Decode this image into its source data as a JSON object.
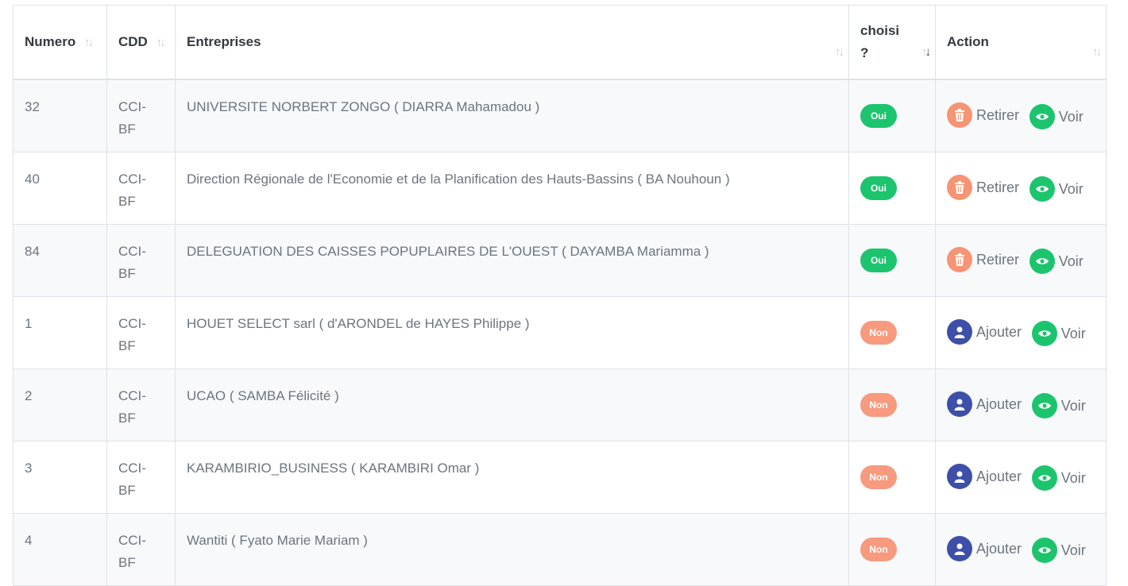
{
  "headers": {
    "numero": "Numero",
    "cdd": "CDD",
    "entreprises": "Entreprises",
    "choisi_line1": "choisi",
    "choisi_line2": "?",
    "action": "Action"
  },
  "sort_icon": {
    "up": "↑",
    "down": "↓"
  },
  "rows": [
    {
      "numero": "32",
      "cdd_1": "CCI-",
      "cdd_2": "BF",
      "entreprise": "UNIVERSITE NORBERT ZONGO ( DIARRA Mahamadou )",
      "choisi": "Oui",
      "action1": "Retirer",
      "action2": "Voir"
    },
    {
      "numero": "40",
      "cdd_1": "CCI-",
      "cdd_2": "BF",
      "entreprise": "Direction Régionale de l'Economie et de la Planification des Hauts-Bassins ( BA Nouhoun )",
      "choisi": "Oui",
      "action1": "Retirer",
      "action2": "Voir"
    },
    {
      "numero": "84",
      "cdd_1": "CCI-",
      "cdd_2": "BF",
      "entreprise": "DELEGUATION DES CAISSES POPUPLAIRES DE L'OUEST ( DAYAMBA Mariamma )",
      "choisi": "Oui",
      "action1": "Retirer",
      "action2": "Voir"
    },
    {
      "numero": "1",
      "cdd_1": "CCI-",
      "cdd_2": "BF",
      "entreprise": "HOUET SELECT sarl ( d'ARONDEL de HAYES Philippe )",
      "choisi": "Non",
      "action1": "Ajouter",
      "action2": "Voir"
    },
    {
      "numero": "2",
      "cdd_1": "CCI-",
      "cdd_2": "BF",
      "entreprise": "UCAO ( SAMBA Félicité )",
      "choisi": "Non",
      "action1": "Ajouter",
      "action2": "Voir"
    },
    {
      "numero": "3",
      "cdd_1": "CCI-",
      "cdd_2": "BF",
      "entreprise": "KARAMBIRIO_BUSINESS ( KARAMBIRI Omar )",
      "choisi": "Non",
      "action1": "Ajouter",
      "action2": "Voir"
    },
    {
      "numero": "4",
      "cdd_1": "CCI-",
      "cdd_2": "BF",
      "entreprise": "Wantiti ( Fyato Marie Mariam )",
      "choisi": "Non",
      "action1": "Ajouter",
      "action2": "Voir"
    }
  ],
  "colors": {
    "oui": "#1dc46e",
    "non": "#f79a7d",
    "retirer": "#f69473",
    "ajouter": "#3d4fa8",
    "voir": "#1dc46e"
  }
}
